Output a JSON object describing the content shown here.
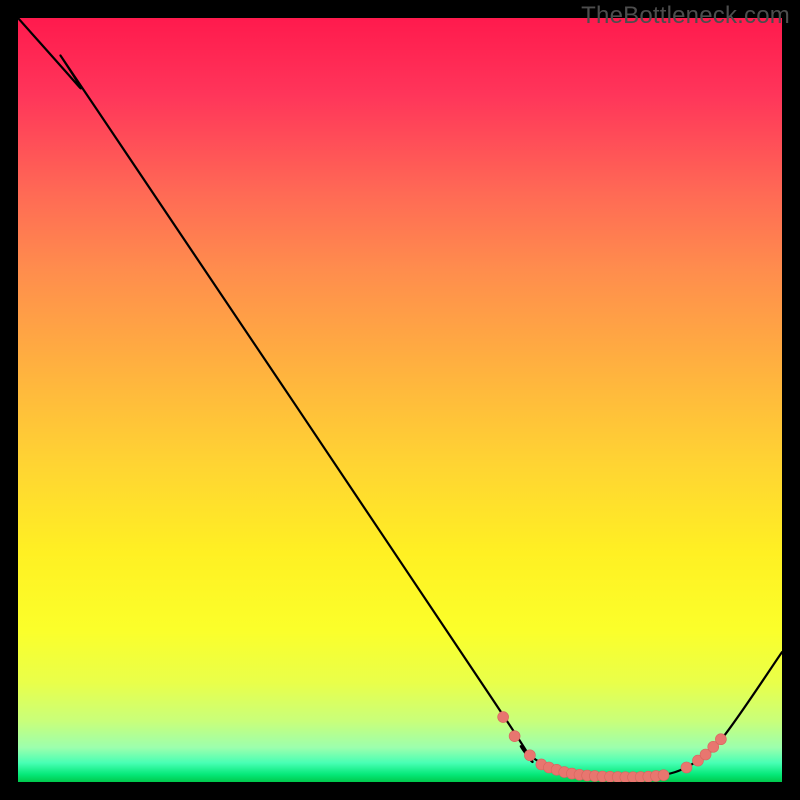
{
  "watermark": "TheBottleneck.com",
  "colors": {
    "curve_stroke": "#000000",
    "marker_fill": "#e8766f",
    "marker_stroke": "#d8655f"
  },
  "chart_data": {
    "type": "line",
    "title": "",
    "xlabel": "",
    "ylabel": "",
    "xlim": [
      0,
      100
    ],
    "ylim": [
      0,
      100
    ],
    "curve": [
      {
        "x": 0,
        "y": 100
      },
      {
        "x": 8,
        "y": 91
      },
      {
        "x": 10,
        "y": 88.5
      },
      {
        "x": 62,
        "y": 11
      },
      {
        "x": 66,
        "y": 4.5
      },
      {
        "x": 70,
        "y": 1.8
      },
      {
        "x": 74,
        "y": 0.8
      },
      {
        "x": 80,
        "y": 0.6
      },
      {
        "x": 84,
        "y": 0.8
      },
      {
        "x": 88,
        "y": 2.2
      },
      {
        "x": 92,
        "y": 5.5
      },
      {
        "x": 100,
        "y": 17
      }
    ],
    "markers": [
      {
        "x": 63.5,
        "y": 8.5
      },
      {
        "x": 65,
        "y": 6.0
      },
      {
        "x": 67,
        "y": 3.5
      },
      {
        "x": 68.5,
        "y": 2.3
      },
      {
        "x": 69.5,
        "y": 1.9
      },
      {
        "x": 70.5,
        "y": 1.6
      },
      {
        "x": 71.5,
        "y": 1.3
      },
      {
        "x": 72.5,
        "y": 1.1
      },
      {
        "x": 73.5,
        "y": 0.95
      },
      {
        "x": 74.5,
        "y": 0.85
      },
      {
        "x": 75.5,
        "y": 0.78
      },
      {
        "x": 76.5,
        "y": 0.72
      },
      {
        "x": 77.5,
        "y": 0.68
      },
      {
        "x": 78.5,
        "y": 0.65
      },
      {
        "x": 79.5,
        "y": 0.63
      },
      {
        "x": 80.5,
        "y": 0.63
      },
      {
        "x": 81.5,
        "y": 0.65
      },
      {
        "x": 82.5,
        "y": 0.7
      },
      {
        "x": 83.5,
        "y": 0.78
      },
      {
        "x": 84.5,
        "y": 0.9
      },
      {
        "x": 87.5,
        "y": 1.9
      },
      {
        "x": 89,
        "y": 2.8
      },
      {
        "x": 90,
        "y": 3.6
      },
      {
        "x": 91,
        "y": 4.6
      },
      {
        "x": 92,
        "y": 5.6
      }
    ]
  }
}
